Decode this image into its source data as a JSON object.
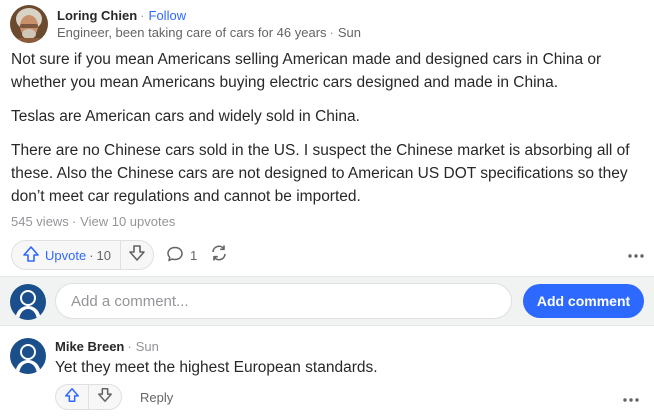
{
  "answer": {
    "author_name": "Loring Chien",
    "follow_label": "Follow",
    "credential": "Engineer, been taking care of cars for 46 years",
    "time": "Sun",
    "paragraphs": [
      "Not sure if you mean Americans selling American made and designed cars in China or whether you mean Americans buying electric cars designed and made in China.",
      "Teslas are American cars and widely sold in China.",
      "There are no Chinese cars sold in the US. I suspect the Chinese market is absorbing all of these. Also the Chinese cars are not designed to American US DOT specifications so they don’t meet car regulations and cannot be imported."
    ],
    "views": "545 views",
    "upvotes_link": "View 10 upvotes",
    "upvote_label": "Upvote",
    "upvote_count": "10",
    "comment_count": "1"
  },
  "comment_box": {
    "placeholder": "Add a comment...",
    "submit_label": "Add comment"
  },
  "reply": {
    "author_name": "Mike Breen",
    "time": "Sun",
    "text": "Yet they meet the highest European standards.",
    "reply_label": "Reply"
  },
  "colors": {
    "accent": "#2e69ff",
    "avatar_default": "#1a4f8b",
    "muted": "#939598"
  },
  "icons": [
    "upvote-arrow-icon",
    "downvote-arrow-icon",
    "comment-bubble-icon",
    "share-cycle-icon",
    "more-dots-icon",
    "default-avatar-icon"
  ]
}
